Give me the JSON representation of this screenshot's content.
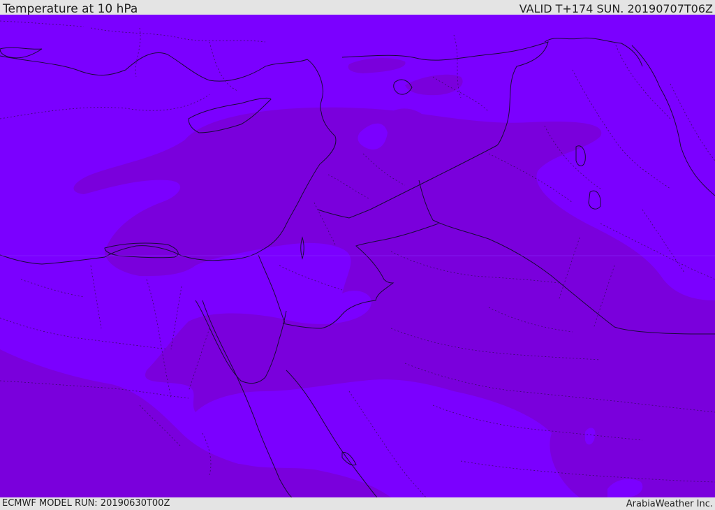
{
  "header": {
    "title": "Temperature at 10 hPa",
    "valid_time": "VALID T+174 SUN. 20190707T06Z"
  },
  "footer": {
    "model_run": "ECMWF MODEL RUN: 20190630T00Z",
    "credit": "ArabiaWeather Inc."
  },
  "map": {
    "field": "Temperature at 10 hPa",
    "region": "Middle East",
    "colors": {
      "background": "#7b00ff",
      "colder_contour_band": "#7a00dc",
      "coastline": "#1a0a3a",
      "border_dotted": "#3a0a6a"
    }
  }
}
